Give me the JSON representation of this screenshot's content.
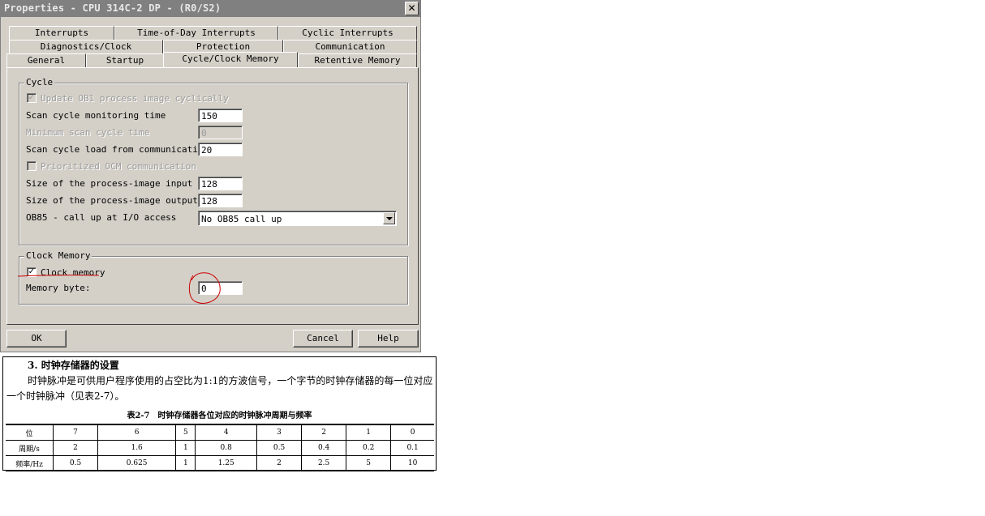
{
  "window": {
    "title": "Properties - CPU 314C-2 DP - (R0/S2)",
    "close_glyph": "✕"
  },
  "tabs": {
    "row1": [
      "Interrupts",
      "Time-of-Day Interrupts",
      "Cyclic Interrupts"
    ],
    "row2": [
      "Diagnostics/Clock",
      "Protection",
      "Communication"
    ],
    "row3": [
      "General",
      "Startup",
      "Cycle/Clock Memory",
      "Retentive Memory"
    ],
    "active": "Cycle/Clock Memory"
  },
  "cycle": {
    "group_title": "Cycle",
    "update_ob1_label": "Update OB1 process image cyclically",
    "update_ob1_checked": true,
    "scan_monitoring_label": "Scan cycle monitoring time",
    "scan_monitoring_value": "150",
    "min_scan_label": "Minimum scan cycle time",
    "min_scan_value": "0",
    "scan_load_label": "Scan cycle load from communication",
    "scan_load_value": "20",
    "prioritized_ocm_label": "Prioritized OCM communication",
    "prioritized_ocm_checked": false,
    "pii_size_label": "Size of the process-image input",
    "pii_size_value": "128",
    "piq_size_label": "Size of the process-image output",
    "piq_size_value": "128",
    "ob85_label": "OB85 - call up at I/O access",
    "ob85_value": "No OB85 call up"
  },
  "clock_memory": {
    "group_title": "Clock Memory",
    "checkbox_label": "Clock memory",
    "checked": true,
    "memory_byte_label": "Memory byte:",
    "memory_byte_value": "0"
  },
  "buttons": {
    "ok": "OK",
    "cancel": "Cancel",
    "help": "Help"
  },
  "annotation_color": "#cc0000",
  "book": {
    "heading": "3. 时钟存储器的设置",
    "paragraph": "时钟脉冲是可供用户程序使用的占空比为1:1的方波信号，一个字节的时钟存储器的每一位对应一个时钟脉冲（见表2-7）。",
    "caption": "表2-7　时钟存储器各位对应的时钟脉冲周期与频率",
    "table": {
      "rows": [
        [
          "位",
          "7",
          "6",
          "5",
          "4",
          "3",
          "2",
          "1",
          "0"
        ],
        [
          "周期/s",
          "2",
          "1.6",
          "1",
          "0.8",
          "0.5",
          "0.4",
          "0.2",
          "0.1"
        ],
        [
          "频率/Hz",
          "0.5",
          "0.625",
          "1",
          "1.25",
          "2",
          "2.5",
          "5",
          "10"
        ]
      ]
    }
  }
}
